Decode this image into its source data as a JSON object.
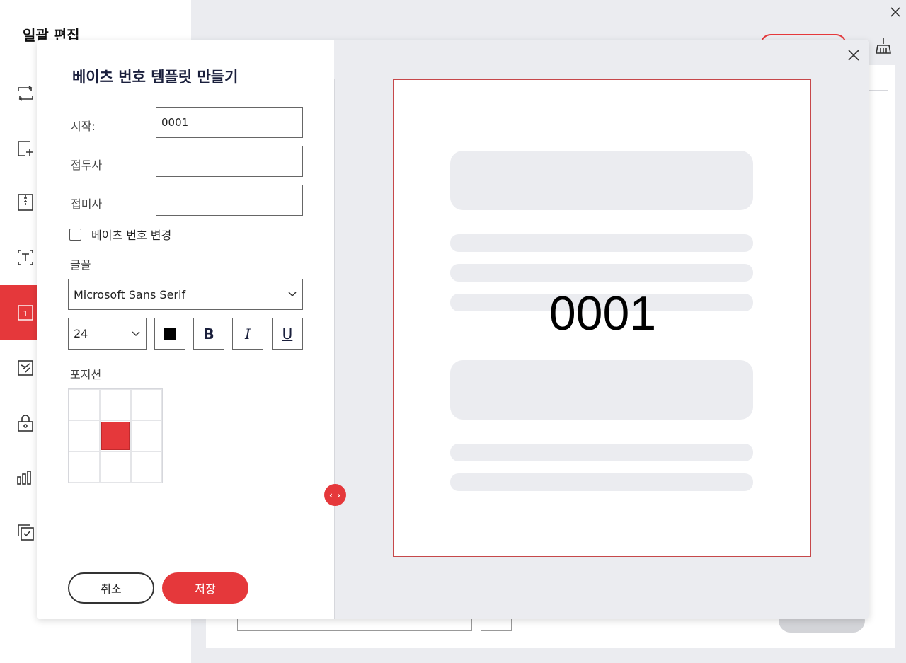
{
  "app": {
    "title": "일괄 편집"
  },
  "modal": {
    "title": "베이츠 번호 템플릿 만들기",
    "fields": {
      "start_label": "시작:",
      "start_value": "0001",
      "prefix_label": "접두사",
      "prefix_value": "",
      "suffix_label": "접미사",
      "suffix_value": ""
    },
    "change_bates_label": "베이츠 번호 변경",
    "change_bates_checked": false,
    "font_section_label": "글꼴",
    "font_family_value": "Microsoft Sans Serif",
    "font_size_value": "24",
    "format_buttons": {
      "color": "black-square-icon",
      "bold": "B",
      "italic": "I",
      "underline": "U"
    },
    "position_section_label": "포지션",
    "position_selected": "middle-center",
    "cancel_label": "취소",
    "save_label": "저장"
  },
  "preview": {
    "number": "0001"
  },
  "colors": {
    "accent": "#e5383b",
    "panel_bg": "#ebecf0",
    "title_text": "#1a1f3c"
  }
}
